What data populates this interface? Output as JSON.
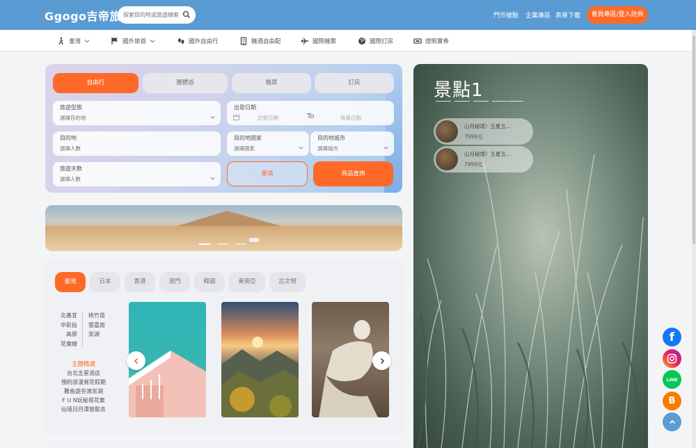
{
  "header": {
    "logo": "Ggogo吉帝旅遊",
    "search_placeholder": "探索目的地或旅遊線索",
    "links": [
      "門市據點",
      "企業專區",
      "表單下載"
    ],
    "login": "會員專區/登入註冊"
  },
  "nav": [
    {
      "label": "臺灣",
      "icon": "hiker-icon"
    },
    {
      "label": "國外旅遊",
      "icon": "flag-icon"
    },
    {
      "label": "國外自由行",
      "icon": "footprints-icon"
    },
    {
      "label": "機酒自由配",
      "icon": "hotel-icon"
    },
    {
      "label": "國際機票",
      "icon": "plane-icon"
    },
    {
      "label": "國際訂房",
      "icon": "globe-icon"
    },
    {
      "label": "證照實券",
      "icon": "ticket-icon"
    }
  ],
  "search": {
    "tabs": [
      "自由行",
      "團體遊",
      "機票",
      "訂房"
    ],
    "type_label": "旅遊型態",
    "type_value": "選擇目的地",
    "date_label": "出發日期",
    "date_from": "出發日期",
    "date_to_sep": "To",
    "date_to": "收黃日期",
    "dest_label": "目的地",
    "dest_value": "選擇人數",
    "country_label": "目的地國家",
    "country_value": "選擇國家",
    "city_label": "目的地城市",
    "city_value": "選擇城市",
    "days_label": "旅遊天數",
    "days_value": "選擇人數",
    "reset": "重填",
    "query": "商品查詢"
  },
  "destinations": {
    "tabs": [
      "臺灣",
      "日本",
      "香港",
      "澳門",
      "韓國",
      "東南亞",
      "古文明"
    ],
    "cities_left": [
      "北基宜",
      "中彰投",
      "高屏",
      "花東線"
    ],
    "cities_right": [
      "桃竹苗",
      "雲嘉南",
      "澎湖"
    ],
    "theme_title": "主題精選",
    "themes": [
      "台北五星酒店",
      "預約浪漫賞花假期",
      "難島遊夯澳澎湖",
      "F U N玩秘境花東",
      "仙境日月潭放鬆去"
    ]
  },
  "scenic": {
    "title": "景點1",
    "spots": [
      {
        "name": "山月秘境〉五星五...",
        "price": "7999元"
      },
      {
        "name": "山月秘境〉五星五...",
        "price": "7999元"
      }
    ]
  },
  "social": {
    "facebook": "f",
    "line": "LINE",
    "blogger": "B",
    "colors": {
      "facebook": "#1877f2",
      "line": "#06c755",
      "blogger": "#f57d00",
      "top": "#5a9bd4"
    }
  }
}
